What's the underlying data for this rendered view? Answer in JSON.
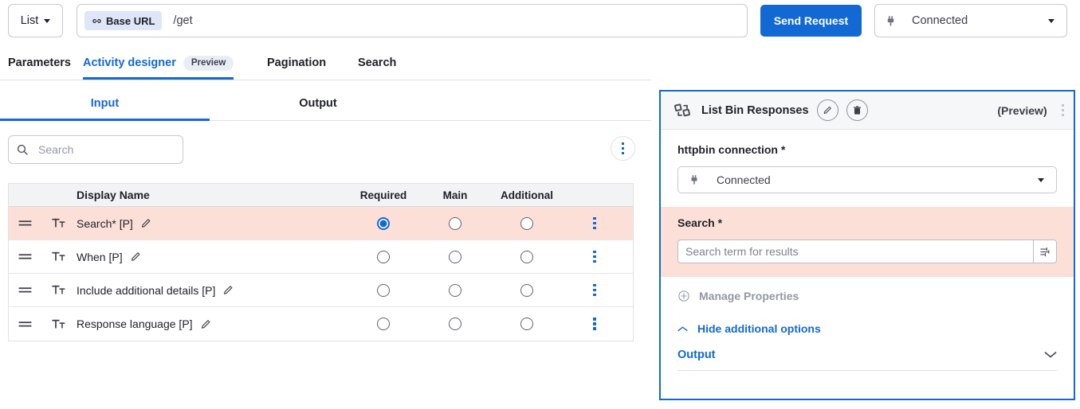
{
  "topbar": {
    "method": {
      "label": "List",
      "icon": "chevron-down-icon"
    },
    "url": {
      "chip_label": "Base URL",
      "chip_icon": "link-icon",
      "path": "/get"
    },
    "send_button": "Send Request",
    "connection": {
      "label": "Connected",
      "icon": "plug-icon"
    }
  },
  "main_tabs": [
    {
      "label": "Parameters",
      "active": false
    },
    {
      "label": "Activity designer",
      "active": true,
      "badge": "Preview"
    },
    {
      "label": "Pagination",
      "active": false
    },
    {
      "label": "Search",
      "active": false
    }
  ],
  "io_tabs": [
    {
      "label": "Input",
      "active": true
    },
    {
      "label": "Output",
      "active": false
    }
  ],
  "grid": {
    "search_placeholder": "Search",
    "search_value": "",
    "search_icon": "search-icon",
    "kebab_icon": "more-vertical-icon",
    "columns": [
      "Display Name",
      "Required",
      "Main",
      "Additional"
    ],
    "rows": [
      {
        "display_name": "Search* [P]",
        "type_icon": "text-type-icon",
        "handle_icon": "drag-handle-icon",
        "edit_icon": "pencil-icon",
        "required": true,
        "main": false,
        "additional": false,
        "highlighted": true
      },
      {
        "display_name": "When [P]",
        "type_icon": "text-type-icon",
        "handle_icon": "drag-handle-icon",
        "edit_icon": "pencil-icon",
        "required": false,
        "main": false,
        "additional": false,
        "highlighted": false
      },
      {
        "display_name": "Include additional details [P]",
        "type_icon": "text-type-icon",
        "handle_icon": "drag-handle-icon",
        "edit_icon": "pencil-icon",
        "required": false,
        "main": false,
        "additional": false,
        "highlighted": false
      },
      {
        "display_name": "Response language [P]",
        "type_icon": "text-type-icon",
        "handle_icon": "drag-handle-icon",
        "edit_icon": "pencil-icon",
        "required": false,
        "main": false,
        "additional": false,
        "highlighted": false
      }
    ]
  },
  "panel": {
    "icon": "activity-icon",
    "title": "List Bin Responses",
    "edit_icon": "pencil-icon",
    "delete_icon": "trash-icon",
    "preview_label": "(Preview)",
    "kebab_icon": "more-vertical-icon",
    "connection_field": {
      "label": "httpbin connection *",
      "value": "Connected",
      "icon": "plug-icon",
      "caret_icon": "chevron-down-icon"
    },
    "search_field": {
      "label": "Search *",
      "value": "",
      "placeholder": "Search term for results",
      "adornment_icon": "sliders-icon",
      "highlighted": true
    },
    "manage_properties": {
      "label": "Manage Properties",
      "icon": "plus-circle-icon"
    },
    "hide_additional": {
      "label": "Hide additional options",
      "icon": "chevron-up-icon"
    },
    "output_section": {
      "label": "Output",
      "icon": "chevron-down-icon"
    }
  },
  "colors": {
    "accent": "#1269d3",
    "highlight_row": "#fce0d8",
    "chip_bg": "#dfe6f7",
    "header_bg": "#f2f3f5",
    "muted_text": "#9298a5"
  }
}
